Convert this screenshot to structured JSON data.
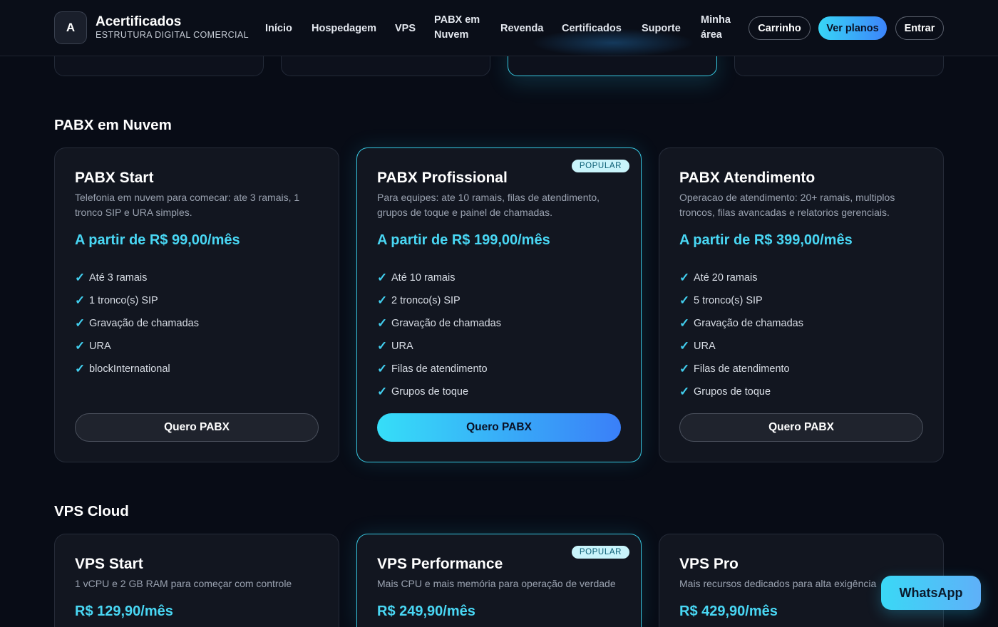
{
  "brand": {
    "mark": "A",
    "name": "Acertificados",
    "tagline": "ESTRUTURA DIGITAL COMERCIAL"
  },
  "nav": {
    "items": [
      {
        "label": "Início"
      },
      {
        "label": "Hospedagem"
      },
      {
        "label": "VPS"
      },
      {
        "line1": "PABX em",
        "line2": "Nuvem"
      },
      {
        "label": "Revenda"
      },
      {
        "label": "Certificados"
      },
      {
        "label": "Suporte"
      },
      {
        "line1": "Minha",
        "line2": "área"
      }
    ],
    "cart_label": "Carrinho",
    "plans_label": "Ver planos",
    "login_label": "Entrar"
  },
  "pabx": {
    "section_title": "PABX em Nuvem",
    "plans": [
      {
        "name": "PABX Start",
        "description": "Telefonia em nuvem para comecar: ate 3 ramais, 1 tronco SIP e URA simples.",
        "price": "A partir de R$ 99,00/mês",
        "features": [
          "Até 3 ramais",
          "1 tronco(s) SIP",
          "Gravação de chamadas",
          "URA",
          "blockInternational"
        ],
        "button": "Quero PABX"
      },
      {
        "name": "PABX Profissional",
        "badge": "POPULAR",
        "description": "Para equipes: ate 10 ramais, filas de atendimento, grupos de toque e painel de chamadas.",
        "price": "A partir de R$ 199,00/mês",
        "features": [
          "Até 10 ramais",
          "2 tronco(s) SIP",
          "Gravação de chamadas",
          "URA",
          "Filas de atendimento",
          "Grupos de toque"
        ],
        "button": "Quero PABX"
      },
      {
        "name": "PABX Atendimento",
        "description": "Operacao de atendimento: 20+ ramais, multiplos troncos, filas avancadas e relatorios gerenciais.",
        "price": "A partir de R$ 399,00/mês",
        "features": [
          "Até 20 ramais",
          "5 tronco(s) SIP",
          "Gravação de chamadas",
          "URA",
          "Filas de atendimento",
          "Grupos de toque"
        ],
        "button": "Quero PABX"
      }
    ]
  },
  "vps": {
    "section_title": "VPS Cloud",
    "plans": [
      {
        "name": "VPS Start",
        "description": "1 vCPU e 2 GB RAM para começar com controle",
        "price": "R$ 129,90/mês"
      },
      {
        "name": "VPS Performance",
        "badge": "POPULAR",
        "description": "Mais CPU e mais memória para operação de verdade",
        "price": "R$ 249,90/mês"
      },
      {
        "name": "VPS Pro",
        "description": "Mais recursos dedicados para alta exigência",
        "price": "R$ 429,90/mês"
      }
    ]
  },
  "whatsapp": {
    "label": "WhatsApp"
  },
  "colors": {
    "accent": "#49d7f4",
    "gradient_start": "#36def8",
    "gradient_end": "#3a7ff8",
    "background": "#080c16",
    "card": "#121620"
  }
}
